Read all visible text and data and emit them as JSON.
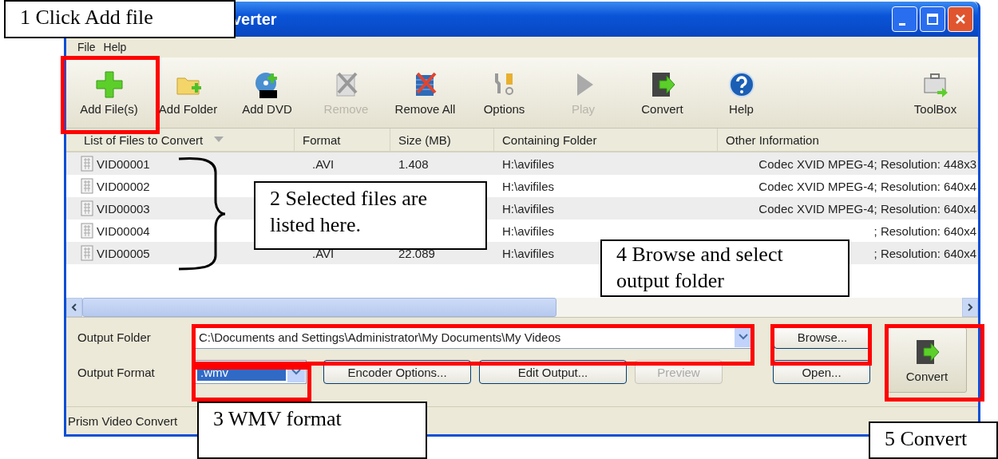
{
  "window": {
    "title": "verter"
  },
  "menu": [
    "File",
    "Help"
  ],
  "toolbar": [
    {
      "kind": "add-file",
      "label": "Add File(s)",
      "disabled": false
    },
    {
      "kind": "add-folder",
      "label": "Add Folder",
      "disabled": false
    },
    {
      "kind": "add-dvd",
      "label": "Add DVD",
      "disabled": false
    },
    {
      "kind": "remove",
      "label": "Remove",
      "disabled": true
    },
    {
      "kind": "remove-all",
      "label": "Remove All",
      "disabled": false
    },
    {
      "kind": "options",
      "label": "Options",
      "disabled": false
    },
    {
      "kind": "play",
      "label": "Play",
      "disabled": true
    },
    {
      "kind": "convert",
      "label": "Convert",
      "disabled": false
    },
    {
      "kind": "help",
      "label": "Help",
      "disabled": false
    },
    {
      "kind": "toolbox",
      "label": "ToolBox",
      "disabled": false
    }
  ],
  "table": {
    "columns": [
      "List of Files to Convert",
      "Format",
      "Size (MB)",
      "Containing Folder",
      "Other Information"
    ],
    "rows": [
      {
        "name": "VID00001",
        "format": ".AVI",
        "size": "1.408",
        "folder": "H:\\avifiles",
        "info": "Codec XVID MPEG-4; Resolution: 448x3"
      },
      {
        "name": "VID00002",
        "folder": "H:\\avifiles",
        "info": "Codec XVID MPEG-4; Resolution: 640x4"
      },
      {
        "name": "VID00003",
        "folder": "H:\\avifiles",
        "info": "Codec XVID MPEG-4; Resolution: 640x4"
      },
      {
        "name": "VID00004",
        "folder": "H:\\avifiles",
        "info": "; Resolution: 640x4"
      },
      {
        "name": "VID00005",
        "format": ".AVI",
        "size": "22.089",
        "folder": "H:\\avifiles",
        "info": "; Resolution: 640x4"
      }
    ]
  },
  "output": {
    "folder_label": "Output Folder",
    "folder_value": "C:\\Documents and Settings\\Administrator\\My Documents\\My Videos",
    "format_label": "Output Format",
    "format_value": ".wmv",
    "buttons": [
      {
        "label": "Encoder Options...",
        "disabled": false
      },
      {
        "label": "Edit Output...",
        "disabled": false
      },
      {
        "label": "Preview",
        "disabled": true
      }
    ],
    "browse": "Browse...",
    "open": "Open...",
    "convert": "Convert"
  },
  "status_bar": "Prism Video Convert",
  "callouts": [
    "1 Click Add file",
    "2 Selected files are listed here.",
    "4 Browse and select output folder",
    "3 WMV format",
    "5 Convert"
  ]
}
